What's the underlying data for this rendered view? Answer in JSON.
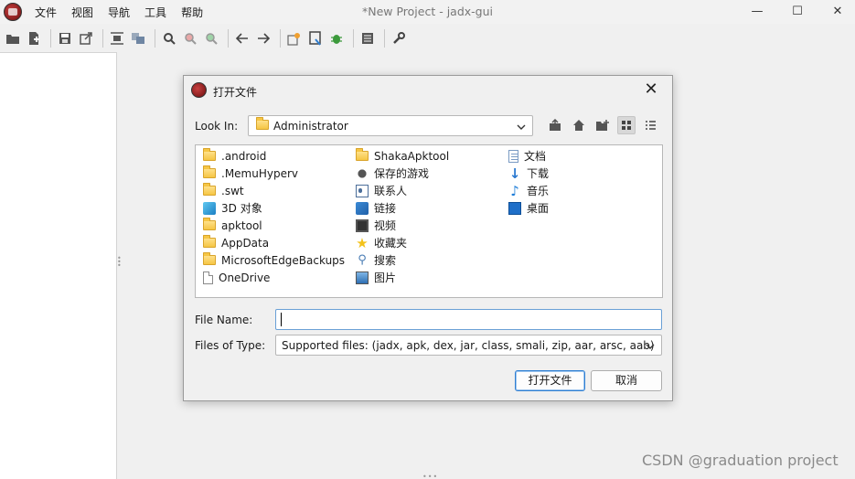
{
  "window": {
    "title": "*New Project - jadx-gui",
    "menu": [
      "文件",
      "视图",
      "导航",
      "工具",
      "帮助"
    ],
    "controls": [
      "—",
      "☐",
      "✕"
    ]
  },
  "toolbar": {
    "icons": [
      "open-folder-icon",
      "add-file-icon",
      "save-icon",
      "export-icon",
      "sync-icon",
      "flatten-icon",
      "search-icon",
      "find-class-icon",
      "find-usage-icon",
      "back-icon",
      "forward-icon",
      "deobfuscate-icon",
      "quark-icon",
      "debug-icon",
      "log-icon",
      "preferences-icon"
    ]
  },
  "dialog": {
    "title": "打开文件",
    "close_glyph": "✕",
    "look_in_label": "Look In:",
    "look_in_value": "Administrator",
    "file_name_label": "File Name:",
    "file_name_value": "",
    "files_of_type_label": "Files of Type:",
    "files_of_type_value": "Supported files: (jadx, apk, dex, jar, class, smali, zip, aar, arsc, aab)",
    "open_button": "打开文件",
    "cancel_button": "取消",
    "files": {
      "col1": [
        {
          "name": ".android",
          "icon": "folder-icon"
        },
        {
          "name": ".MemuHyperv",
          "icon": "folder-icon"
        },
        {
          "name": ".swt",
          "icon": "folder-icon"
        },
        {
          "name": "3D 对象",
          "icon": "3d-objects-icon"
        },
        {
          "name": "apktool",
          "icon": "folder-icon"
        },
        {
          "name": "AppData",
          "icon": "folder-icon"
        },
        {
          "name": "MicrosoftEdgeBackups",
          "icon": "folder-icon"
        },
        {
          "name": "OneDrive",
          "icon": "file-icon"
        }
      ],
      "col2": [
        {
          "name": "ShakaApktool",
          "icon": "folder-icon"
        },
        {
          "name": "保存的游戏",
          "icon": "saved-games-icon"
        },
        {
          "name": "联系人",
          "icon": "contacts-icon"
        },
        {
          "name": "链接",
          "icon": "links-icon"
        },
        {
          "name": "视频",
          "icon": "videos-icon"
        },
        {
          "name": "收藏夹",
          "icon": "favorites-icon"
        },
        {
          "name": "搜索",
          "icon": "searches-icon"
        },
        {
          "name": "图片",
          "icon": "pictures-icon"
        }
      ],
      "col3": [
        {
          "name": "文档",
          "icon": "documents-icon"
        },
        {
          "name": "下载",
          "icon": "downloads-icon"
        },
        {
          "name": "音乐",
          "icon": "music-icon"
        },
        {
          "name": "桌面",
          "icon": "desktop-icon"
        }
      ]
    }
  },
  "watermark": "CSDN @graduation project"
}
